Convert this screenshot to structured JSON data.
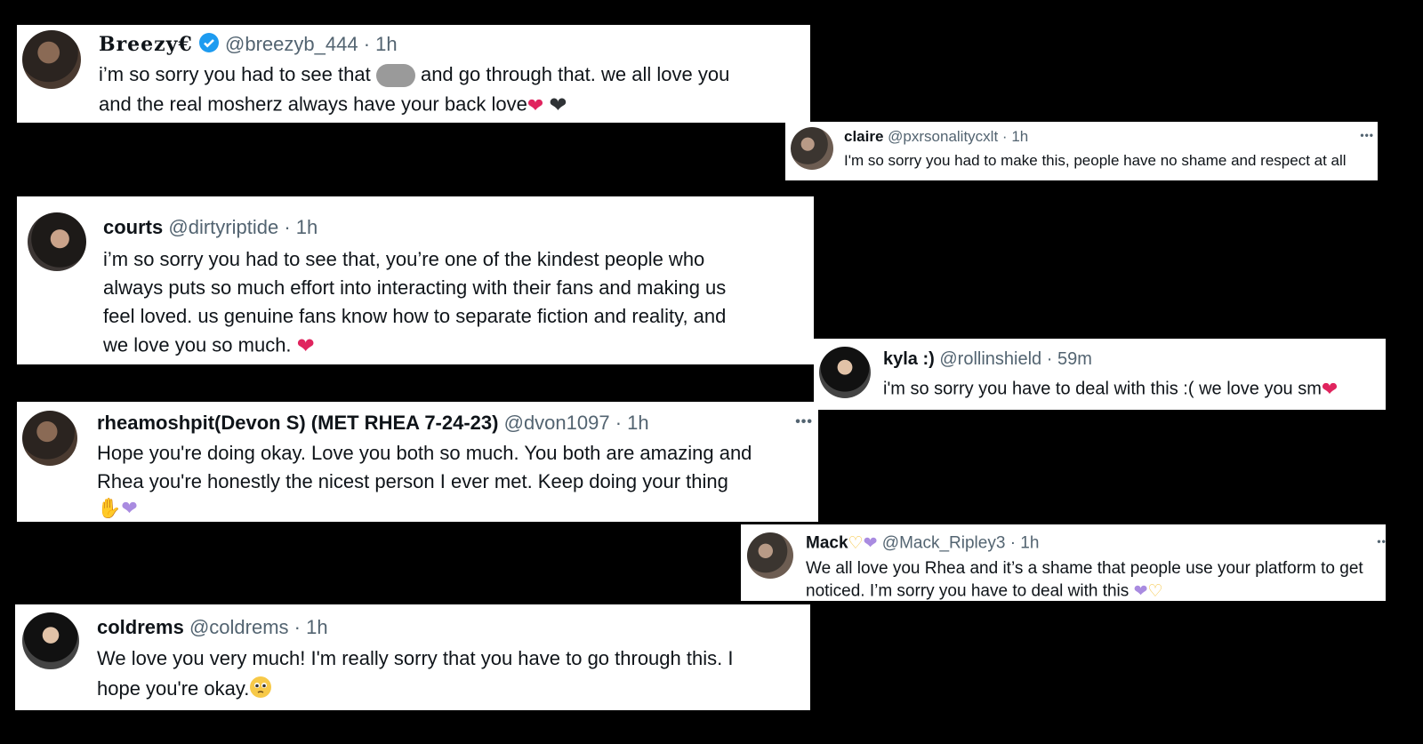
{
  "cards": [
    {
      "id": "breezy",
      "name": "Breezy€",
      "handle": "@breezyb_444",
      "time": "1h",
      "line1_a": "i’m so sorry you had to see that",
      "line1_b": "and go through that. we all love you",
      "line2": "and the real mosherz always have your back love"
    },
    {
      "id": "claire",
      "name": "claire",
      "handle": "@pxrsonalitycxlt",
      "time": "1h",
      "line1": "I'm so sorry you had to make this, people have no shame and respect at all"
    },
    {
      "id": "courts",
      "name": "courts",
      "handle": "@dirtyriptide",
      "time": "1h",
      "line1": "i’m so sorry you had to see that, you’re one of the kindest people who",
      "line2": "always puts so much effort into interacting with their fans and making us",
      "line3": "feel loved. us genuine fans know how to separate fiction and reality, and",
      "line4": "we love you so much."
    },
    {
      "id": "kyla",
      "name": "kyla :)",
      "handle": "@rollinshield",
      "time": "59m",
      "line1": "i'm so sorry you have to deal with this :( we love you sm"
    },
    {
      "id": "rhea",
      "name": "rheamoshpit(Devon S) (MET RHEA 7-24-23)",
      "handle": "@dvon1097",
      "time": "1h",
      "line1": "Hope you're doing okay. Love you both so much. You both are amazing and",
      "line2": "Rhea you're honestly the nicest person I ever met. Keep doing your thing"
    },
    {
      "id": "mack",
      "name": "Mack",
      "handle": "@Mack_Ripley3",
      "time": "1h",
      "line1": "We all love you Rhea and it’s a shame that people use your platform to get",
      "line2": "noticed. I’m sorry you have to deal with this"
    },
    {
      "id": "coldrems",
      "name": "coldrems",
      "handle": "@coldrems",
      "time": "1h",
      "line1": "We love you very much! I'm really sorry that you have to go through this. I",
      "line2": "hope you're okay."
    }
  ],
  "more_label": "•••",
  "dot": "·",
  "icons": {
    "verified": "verified-badge-icon",
    "red_heart": "❤",
    "black_heart": "🖤",
    "purple_heart": "💜",
    "flexed_bicep": "💪",
    "pleading_face": "🥺",
    "heart_hands": "🫶"
  },
  "colors": {
    "background": "#000000",
    "card": "#ffffff",
    "meta": "#536471",
    "verified": "#1d9bf0",
    "red_heart": "#e0245e",
    "purple_heart": "#a98be0"
  }
}
